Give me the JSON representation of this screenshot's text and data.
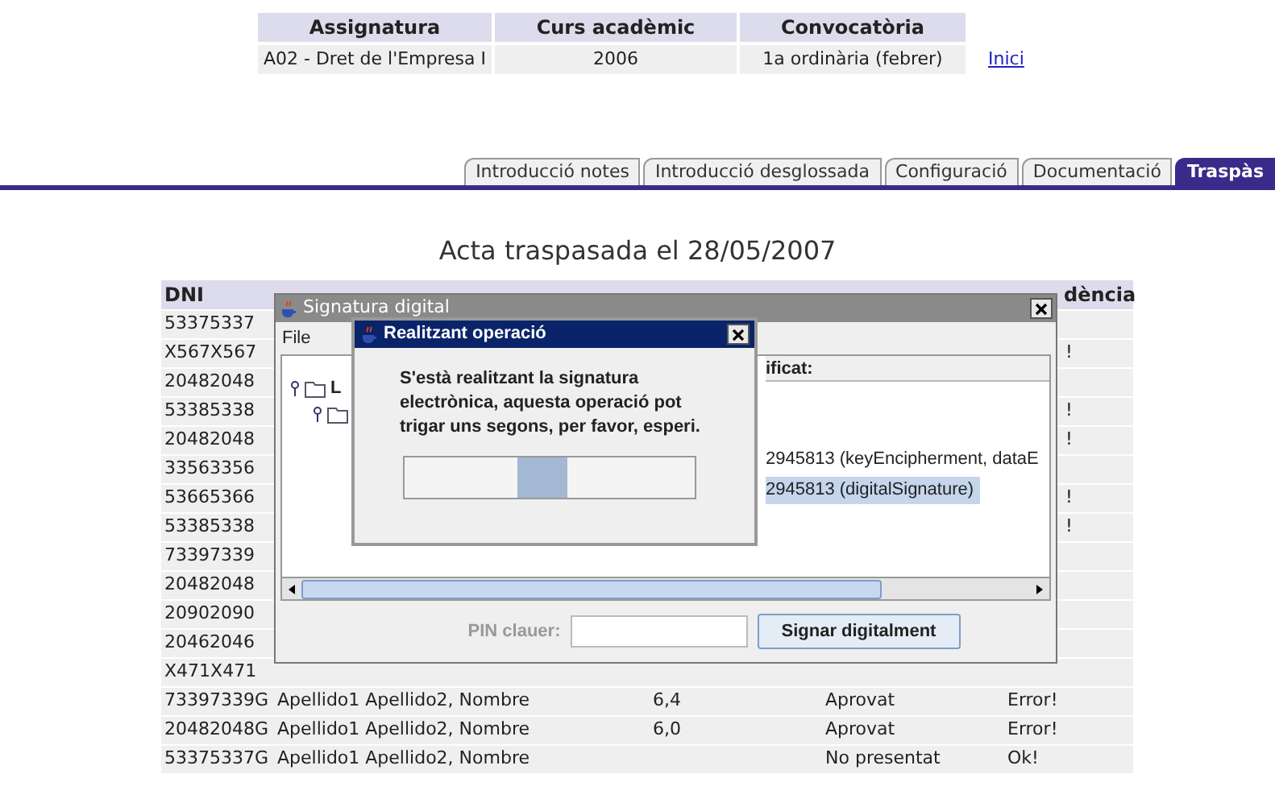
{
  "course_info": {
    "columns": [
      "Assignatura",
      "Curs acadèmic",
      "Convocatòria"
    ],
    "values": [
      "A02 - Dret de l'Empresa I",
      "2006",
      "1a ordinària (febrer)"
    ],
    "link": "Inici"
  },
  "tabs": [
    {
      "label": "Introducció notes",
      "selected": false
    },
    {
      "label": "Introducció desglossada",
      "selected": false
    },
    {
      "label": "Configuració",
      "selected": false
    },
    {
      "label": "Documentació",
      "selected": false
    },
    {
      "label": "Traspàs",
      "selected": true
    }
  ],
  "title": "Acta traspasada el 28/05/2007",
  "table": {
    "columns": [
      "DNI",
      "dència"
    ],
    "rows": [
      {
        "dni": "53375337"
      },
      {
        "dni": "X567X567",
        "incidence": "!"
      },
      {
        "dni": "20482048"
      },
      {
        "dni": "53385338",
        "incidence": "!"
      },
      {
        "dni": "20482048",
        "incidence": "!"
      },
      {
        "dni": "33563356"
      },
      {
        "dni": "53665366",
        "incidence": "!"
      },
      {
        "dni": "53385338",
        "incidence": "!"
      },
      {
        "dni": "73397339"
      },
      {
        "dni": "20482048"
      },
      {
        "dni": "20902090"
      },
      {
        "dni": "20462046"
      },
      {
        "dni": "X471X471"
      },
      {
        "dni": "73397339G",
        "name": "Apellido1 Apellido2, Nombre",
        "numeric": "6,4",
        "textual": "Aprovat",
        "incidence": "Error!"
      },
      {
        "dni": "20482048G",
        "name": "Apellido1 Apellido2, Nombre",
        "numeric": "6,0",
        "textual": "Aprovat",
        "incidence": "Error!"
      },
      {
        "dni": "53375337G",
        "name": "Apellido1 Apellido2, Nombre",
        "textual": "No presentat",
        "incidence": "Ok!"
      }
    ]
  },
  "signature_window": {
    "title": "Signatura digital",
    "menu": [
      "File"
    ],
    "tree": [
      {
        "label": "L",
        "expanded": true,
        "children": [
          {
            "expanded": true
          }
        ]
      }
    ],
    "list_header": "ificat:",
    "certificates": [
      {
        "label": "2945813 (keyEncipherment, dataE",
        "selected": false
      },
      {
        "label": "2945813 (digitalSignature)",
        "selected": true
      }
    ],
    "pin_label": "PIN clauer:",
    "sign_button": "Signar digitalment"
  },
  "progress_dialog": {
    "title": "Realitzant operació",
    "message": "S'està realitzant la signatura electrònica, aquesta operació pot trigar uns segons, per favor, esperi.",
    "progress": {
      "indeterminate": true
    }
  }
}
